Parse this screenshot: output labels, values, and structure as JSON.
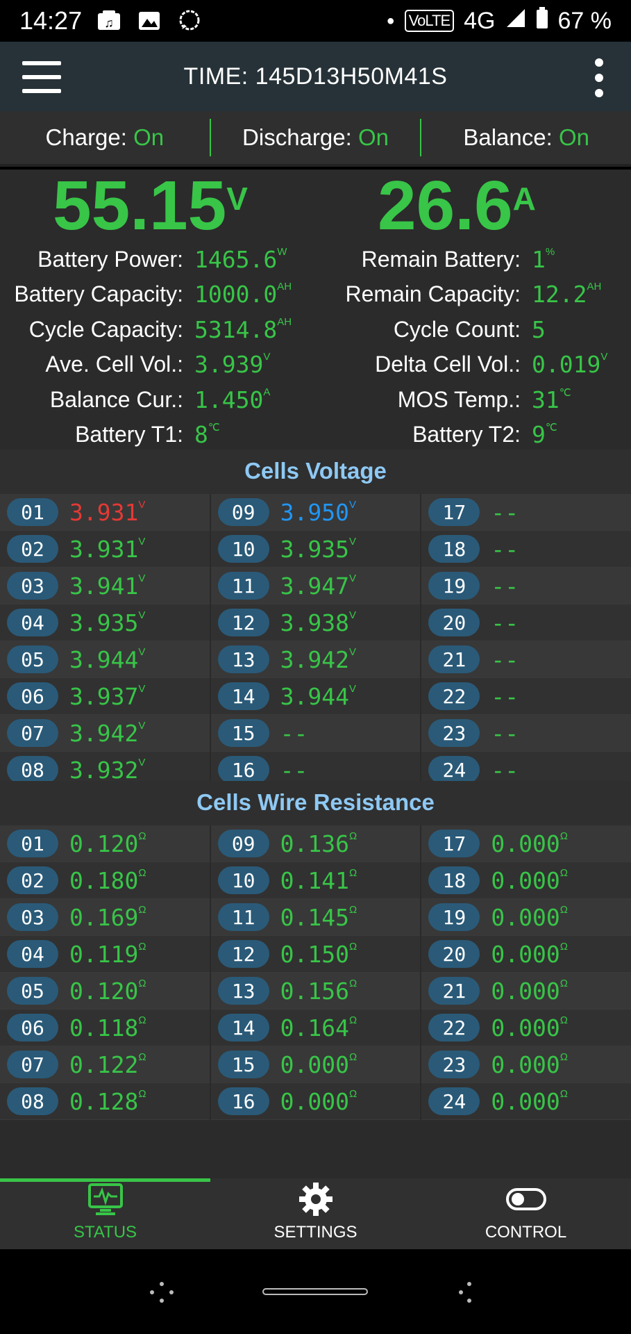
{
  "statusbar": {
    "time": "14:27",
    "volte": "VoLTE",
    "network": "4G",
    "battery": "67 %"
  },
  "appbar": {
    "title": "TIME: 145D13H50M41S"
  },
  "switches": [
    {
      "label": "Charge: ",
      "state": "On"
    },
    {
      "label": "Discharge: ",
      "state": "On"
    },
    {
      "label": "Balance: ",
      "state": "On"
    }
  ],
  "big": {
    "voltage": "55.15",
    "voltage_unit": "V",
    "current": "26.6",
    "current_unit": "A"
  },
  "info_rows": [
    {
      "l_label": "Battery Power:",
      "l_val": "1465.6",
      "l_unit": "W",
      "r_label": "Remain Battery:",
      "r_val": "1",
      "r_unit": "%"
    },
    {
      "l_label": "Battery Capacity:",
      "l_val": "1000.0",
      "l_unit": "AH",
      "r_label": "Remain Capacity:",
      "r_val": "12.2",
      "r_unit": "AH"
    },
    {
      "l_label": "Cycle Capacity:",
      "l_val": "5314.8",
      "l_unit": "AH",
      "r_label": "Cycle Count:",
      "r_val": "5",
      "r_unit": ""
    },
    {
      "l_label": "Ave. Cell Vol.:",
      "l_val": "3.939",
      "l_unit": "V",
      "r_label": "Delta Cell Vol.:",
      "r_val": "0.019",
      "r_unit": "V"
    },
    {
      "l_label": "Balance Cur.:",
      "l_val": "1.450",
      "l_unit": "A",
      "r_label": "MOS Temp.:",
      "r_val": "31",
      "r_unit": "℃"
    },
    {
      "l_label": "Battery T1:",
      "l_val": "8",
      "l_unit": "℃",
      "r_label": "Battery T2:",
      "r_val": "9",
      "r_unit": "℃"
    }
  ],
  "cells_voltage": {
    "title": "Cells Voltage",
    "unit": "V",
    "cells": [
      {
        "id": "01",
        "value": "3.931",
        "status": "min"
      },
      {
        "id": "02",
        "value": "3.931"
      },
      {
        "id": "03",
        "value": "3.941"
      },
      {
        "id": "04",
        "value": "3.935"
      },
      {
        "id": "05",
        "value": "3.944"
      },
      {
        "id": "06",
        "value": "3.937"
      },
      {
        "id": "07",
        "value": "3.942"
      },
      {
        "id": "08",
        "value": "3.932"
      },
      {
        "id": "09",
        "value": "3.950",
        "status": "max"
      },
      {
        "id": "10",
        "value": "3.935"
      },
      {
        "id": "11",
        "value": "3.947"
      },
      {
        "id": "12",
        "value": "3.938"
      },
      {
        "id": "13",
        "value": "3.942"
      },
      {
        "id": "14",
        "value": "3.944"
      },
      {
        "id": "15",
        "value": "--"
      },
      {
        "id": "16",
        "value": "--"
      },
      {
        "id": "17",
        "value": "--"
      },
      {
        "id": "18",
        "value": "--"
      },
      {
        "id": "19",
        "value": "--"
      },
      {
        "id": "20",
        "value": "--"
      },
      {
        "id": "21",
        "value": "--"
      },
      {
        "id": "22",
        "value": "--"
      },
      {
        "id": "23",
        "value": "--"
      },
      {
        "id": "24",
        "value": "--"
      }
    ]
  },
  "cells_resistance": {
    "title": "Cells Wire Resistance",
    "unit": "Ω",
    "cells": [
      {
        "id": "01",
        "value": "0.120"
      },
      {
        "id": "02",
        "value": "0.180"
      },
      {
        "id": "03",
        "value": "0.169"
      },
      {
        "id": "04",
        "value": "0.119"
      },
      {
        "id": "05",
        "value": "0.120"
      },
      {
        "id": "06",
        "value": "0.118"
      },
      {
        "id": "07",
        "value": "0.122"
      },
      {
        "id": "08",
        "value": "0.128"
      },
      {
        "id": "09",
        "value": "0.136"
      },
      {
        "id": "10",
        "value": "0.141"
      },
      {
        "id": "11",
        "value": "0.145"
      },
      {
        "id": "12",
        "value": "0.150"
      },
      {
        "id": "13",
        "value": "0.156"
      },
      {
        "id": "14",
        "value": "0.164"
      },
      {
        "id": "15",
        "value": "0.000"
      },
      {
        "id": "16",
        "value": "0.000"
      },
      {
        "id": "17",
        "value": "0.000"
      },
      {
        "id": "18",
        "value": "0.000"
      },
      {
        "id": "19",
        "value": "0.000"
      },
      {
        "id": "20",
        "value": "0.000"
      },
      {
        "id": "21",
        "value": "0.000"
      },
      {
        "id": "22",
        "value": "0.000"
      },
      {
        "id": "23",
        "value": "0.000"
      },
      {
        "id": "24",
        "value": "0.000"
      }
    ]
  },
  "bottom_nav": [
    {
      "label": "STATUS",
      "icon": "monitor-pulse-icon",
      "active": true
    },
    {
      "label": "SETTINGS",
      "icon": "gear-icon",
      "active": false
    },
    {
      "label": "CONTROL",
      "icon": "toggle-icon",
      "active": false
    }
  ],
  "colors": {
    "accent": "#38c548",
    "min_cell": "#e53935",
    "max_cell": "#2196f3",
    "section_title": "#8ec9f4",
    "badge": "#2a5a78"
  }
}
